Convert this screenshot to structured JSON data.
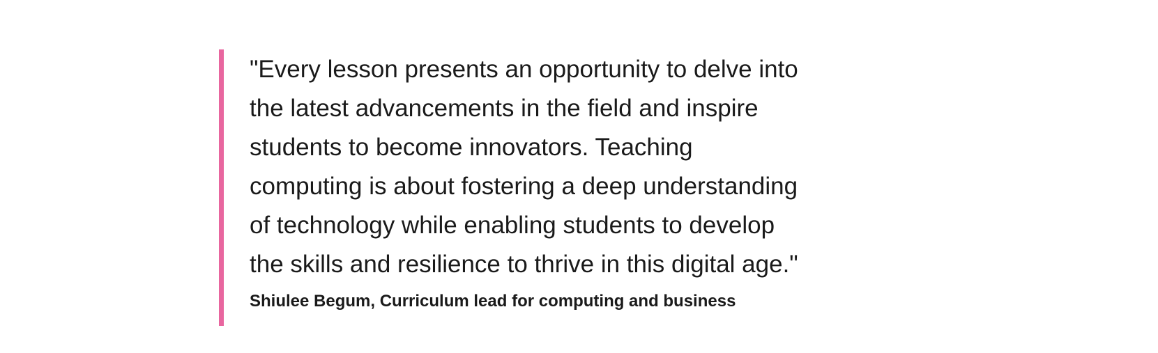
{
  "quote": {
    "text": "\"Every lesson presents an opportunity to delve into\nthe latest advancements in the field and inspire\nstudents to become innovators. Teaching\ncomputing is about fostering a deep understanding\nof technology while enabling students to develop\nthe skills and resilience to thrive in this digital age.\"",
    "attribution": "Shiulee Begum, Curriculum lead for computing and business",
    "accent_color": "#e8669f"
  }
}
